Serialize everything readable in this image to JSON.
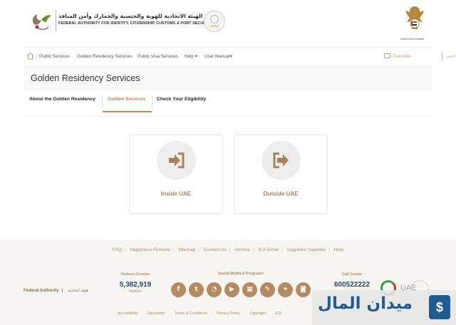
{
  "header": {
    "authority_name_ar": "الهيئة الاتحادية للهوية والجنسية والجمارك وأمن المنافذ",
    "authority_name_en": "FEDERAL AUTHORITY FOR IDENTITY, CITIZENSHIP, CUSTOMS & PORT SECURITY",
    "badge_stars": "★★★★",
    "emblem_label": "United Arab Emirates"
  },
  "nav": {
    "items": [
      "Public Services",
      "Golden Residency Services",
      "Public Visa Services",
      "Help ▾",
      "User Manual▾"
    ],
    "translate": "Translate",
    "language": "عربي"
  },
  "page": {
    "title": "Golden Residency Services"
  },
  "tabs": [
    {
      "label": "About the Golden Residency",
      "active": false
    },
    {
      "label": "Golden Services",
      "active": true
    },
    {
      "label": "Check Your Eligibility",
      "active": false
    }
  ],
  "cards": [
    {
      "label": "Inside UAE",
      "icon": "sign-in-icon"
    },
    {
      "label": "Outside UAE",
      "icon": "sign-out-icon"
    }
  ],
  "footer": {
    "links": [
      "FAQ",
      "Happiness Formula",
      "Sitemap",
      "Contact Us",
      "Archive",
      "ICA Email",
      "Suppliers' Inquiries",
      "Help"
    ],
    "federal_authority_en": "Federal Authority",
    "federal_authority_ar": "هيئة اتحادية",
    "visitors": {
      "heading": "Visitors Counter",
      "count": "5,382,919",
      "sub": "Visitors"
    },
    "social": {
      "heading": "Social Media & Programs",
      "icons": [
        "facebook-icon",
        "twitter-icon",
        "rss-icon",
        "youtube-icon",
        "windows-icon",
        "tools-icon",
        "pdf-icon",
        "instagram-icon"
      ]
    },
    "call": {
      "heading": "Call Center",
      "number": "600522222"
    },
    "uae_text": "UAE",
    "bottom_links": [
      "Accessibility",
      "Disclaimer",
      "Terms & Conditions",
      "Privacy Policy",
      "Copyright",
      "ICA"
    ]
  },
  "watermark": {
    "text": "ميدان المال"
  },
  "colors": {
    "accent": "#b48a5e",
    "dark_blue": "#2c4c66",
    "card_circle": "#ededed"
  }
}
